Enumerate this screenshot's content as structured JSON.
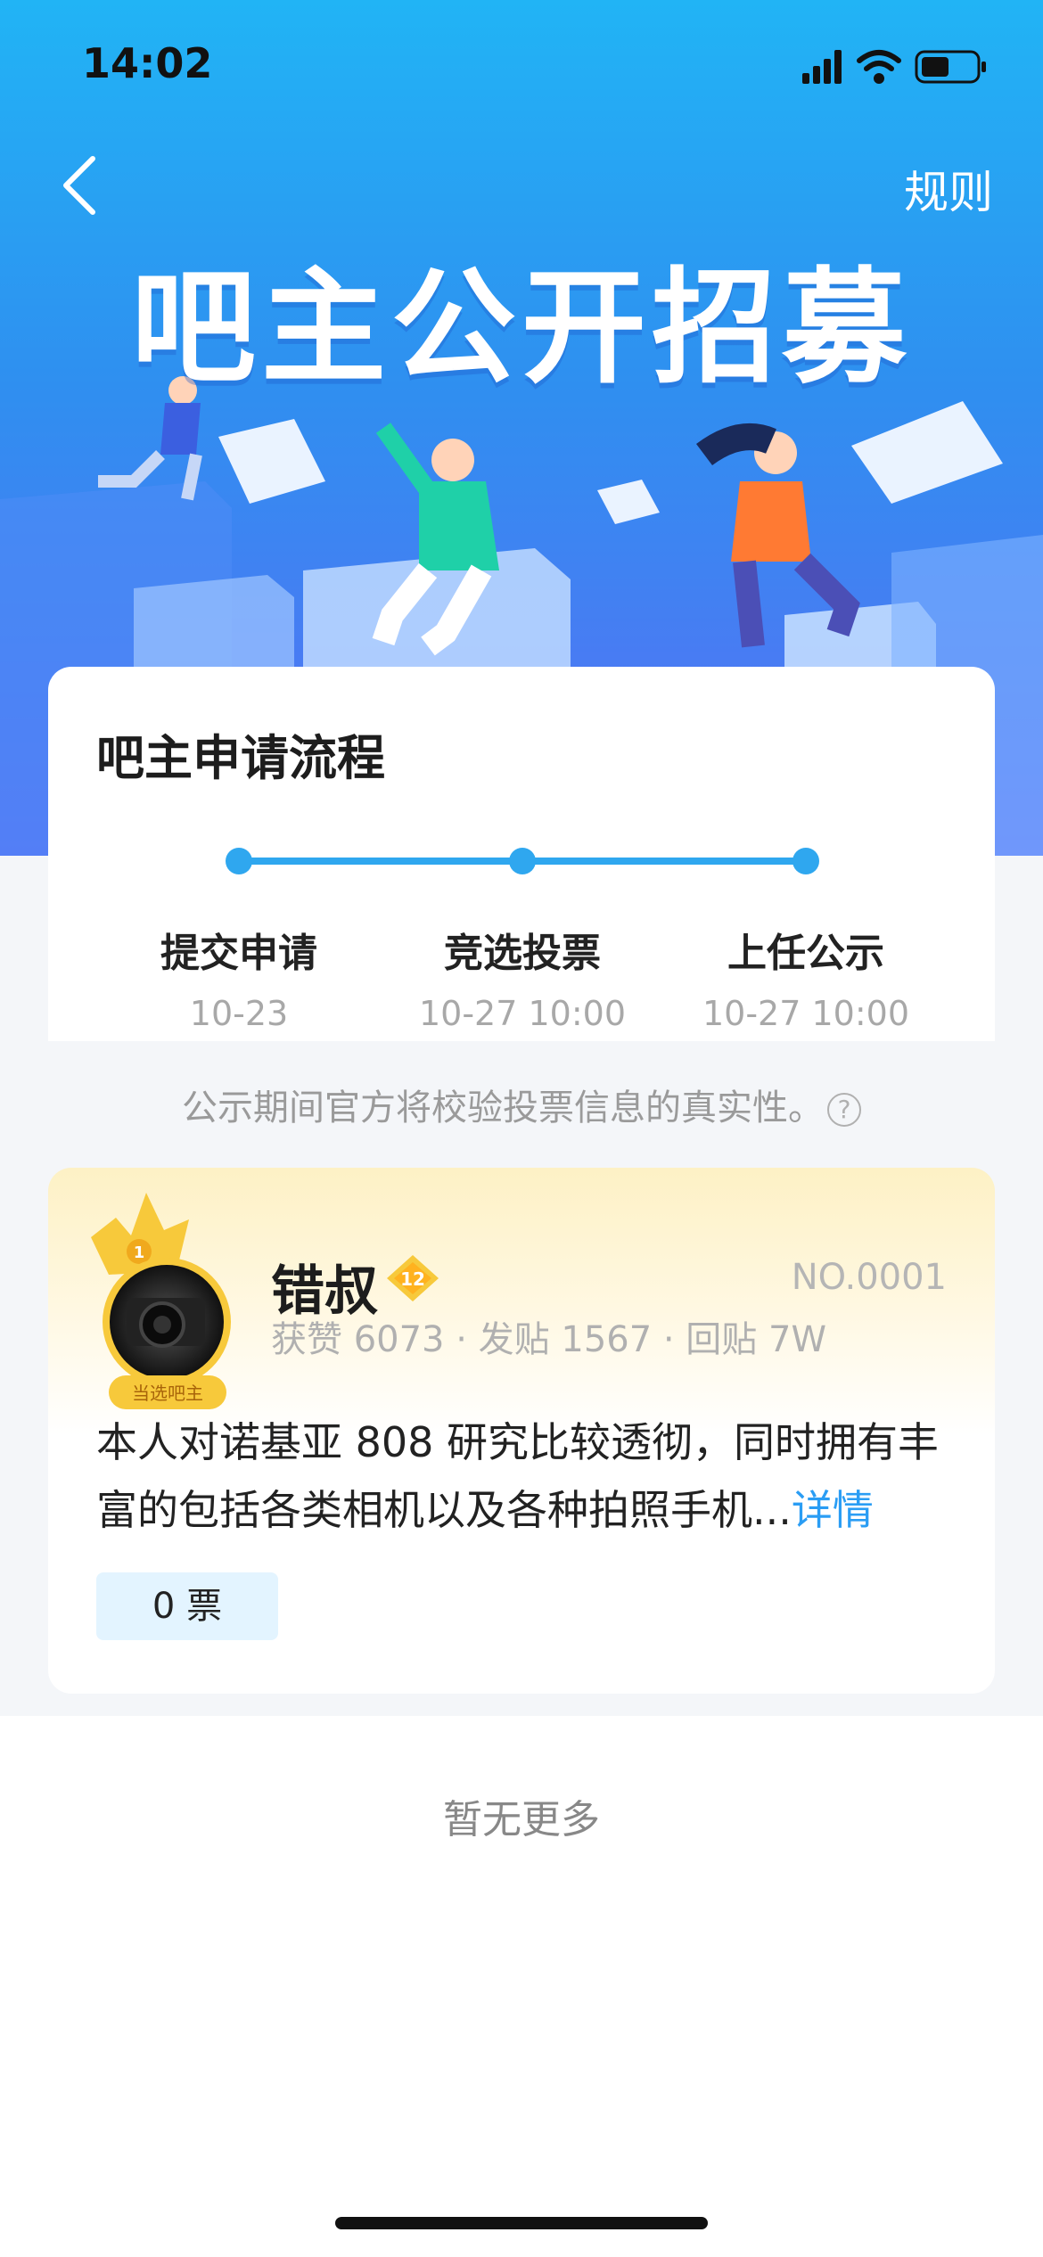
{
  "status_bar": {
    "time": "14:02"
  },
  "nav": {
    "rules_label": "规则"
  },
  "hero": {
    "title": "吧主公开招募"
  },
  "process": {
    "title": "吧主申请流程",
    "steps": [
      {
        "label": "提交申请",
        "time": "10-23"
      },
      {
        "label": "竞选投票",
        "time": "10-27 10:00"
      },
      {
        "label": "上任公示",
        "time": "10-27 10:00"
      }
    ]
  },
  "notice": {
    "text": "公示期间官方将校验投票信息的真实性。"
  },
  "candidate": {
    "name": "错叔",
    "level": "12",
    "number": "NO.0001",
    "badge": "当选吧主",
    "crown_rank": "1",
    "stats": "获赞 6073 · 发贴 1567 · 回贴 7W",
    "description": "本人对诺基亚 808 研究比较透彻，同时拥有丰富的包括各类相机以及各种拍照手机...",
    "detail_link": "详情",
    "votes": "0 票"
  },
  "footer": {
    "text": "暂无更多"
  },
  "colors": {
    "accent": "#2a9df4",
    "hero_top": "#21b4f5",
    "hero_bottom": "#5a6ef5",
    "badge_gold": "#f7c93b"
  }
}
